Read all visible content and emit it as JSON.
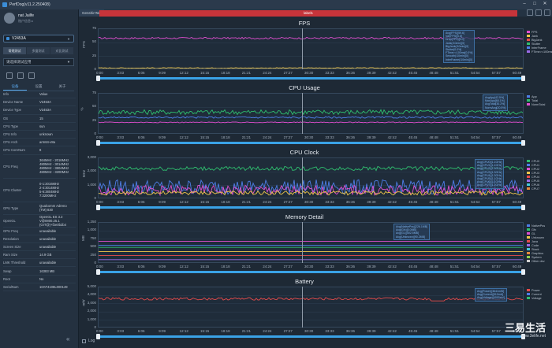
{
  "window": {
    "title": "PerfDog(v11.2.250408)"
  },
  "user": {
    "name": "nat Jailfe",
    "subtitle": "账户信息 ▸"
  },
  "device": {
    "name": "V2453A"
  },
  "mode_tabs": [
    "常规测试",
    "多窗测试",
    "对比测试"
  ],
  "app_select": {
    "placeholder": "请选择测试应用"
  },
  "info_tabs": [
    "设备",
    "设置",
    "关于"
  ],
  "info": [
    {
      "k": "Info",
      "v": "Value"
    },
    {
      "k": "Device Name",
      "v": "V2453A"
    },
    {
      "k": "Device Type",
      "v": "V2453A"
    },
    {
      "k": "OS",
      "v": "15"
    },
    {
      "k": "CPU Type",
      "v": "sun"
    },
    {
      "k": "CPU Info",
      "v": "unknown"
    },
    {
      "k": "CPU Arch",
      "v": "arm64-v8a"
    },
    {
      "k": "CPU CoreNum",
      "v": "8"
    },
    {
      "k": "CPU Freq",
      "v": "364MHz - 2016MHz\n480MHz - 3014MHz\n480MHz - 3804MHz\n480MHz - 3200MHz"
    },
    {
      "k": "CPU Cluster",
      "v": "0-1:2016MHz\n2-4:3014MHz\n5-6:3804MHz\n7:3200MHz"
    },
    {
      "k": "GPU Type",
      "v": "Qualcomm Adreno\n(TM) 830"
    },
    {
      "k": "OpenGL",
      "v": "OpenGL ES 3.2\nV@0800.25.1\n(GIT@)+f2e0b2b4"
    },
    {
      "k": "GPU Freq",
      "v": "unavailable"
    },
    {
      "k": "Resolution",
      "v": "unavailable"
    },
    {
      "k": "Screen Size",
      "v": "unavailable"
    },
    {
      "k": "Ram Size",
      "v": "14.9 GB"
    },
    {
      "k": "LMK Threshold",
      "v": "unavailable"
    },
    {
      "k": "Swap",
      "v": "16383 MB"
    },
    {
      "k": "Root",
      "v": "No"
    },
    {
      "k": "SerialNum",
      "v": "10AF4108L000149"
    }
  ],
  "tabbar": {
    "tab": "GenshinTab",
    "label": "label1"
  },
  "x_ticks": [
    "0:00",
    "3:03",
    "6:06",
    "9:09",
    "12:12",
    "15:15",
    "18:18",
    "21:21",
    "24:24",
    "27:27",
    "30:30",
    "33:33",
    "36:36",
    "39:39",
    "42:42",
    "45:45",
    "48:48",
    "51:51",
    "54:54",
    "57:57",
    "60:49"
  ],
  "panels": [
    {
      "title": "FPS",
      "unit": "FPS",
      "yticks": [
        "75",
        "50",
        "25",
        "0"
      ],
      "ymax": 75,
      "legend": [
        {
          "name": "FPS",
          "color": "#e04fd0"
        },
        {
          "name": "Jank",
          "color": "#f0c64a"
        },
        {
          "name": "BigJank",
          "color": "#e64b4b"
        },
        {
          "name": "Stutter",
          "color": "#2fbf6f"
        },
        {
          "name": "InterFrame",
          "color": "#4d7ee8"
        },
        {
          "name": "FTime>=100ms",
          "color": "#9b6be8"
        }
      ],
      "stats": "Avg(FPS)[59.6]\nVar(FPS)[0.8]\nDrop(FPS)[0.0]\nJank(/10min)[0]\nBigJank(/10min)[0]\nStutter[0.0%]\nFTime>=100ms[0.0%]\nSmooth(/10min)[0]\nInterFrame(/10min)[0]"
    },
    {
      "title": "CPU Usage",
      "unit": "%",
      "yticks": [
        "75",
        "50",
        "25",
        "0"
      ],
      "ymax": 75,
      "legend": [
        {
          "name": "App",
          "color": "#4d7ee8"
        },
        {
          "name": "Total",
          "color": "#2fbf6f"
        },
        {
          "name": "NormTotal",
          "color": "#e04fd0"
        }
      ],
      "stats": "AvgApp[42.5%]\nMaxApp[68.1%]\nAvgTotal[30.2%]\nNormAvg[20.5%]"
    },
    {
      "title": "CPU Clock",
      "unit": "MHz",
      "yticks": [
        "3,000",
        "2,000",
        "1,000",
        "0"
      ],
      "ymax": 4000,
      "legend": [
        {
          "name": "CPU0",
          "color": "#2fbf6f"
        },
        {
          "name": "CPU1",
          "color": "#4d7ee8"
        },
        {
          "name": "CPU2",
          "color": "#e04fd0"
        },
        {
          "name": "CPU3",
          "color": "#f0c64a"
        },
        {
          "name": "CPU4",
          "color": "#e64b4b"
        },
        {
          "name": "CPU5",
          "color": "#9b6be8"
        },
        {
          "name": "CPU6",
          "color": "#45c9d8"
        },
        {
          "name": "CPU7",
          "color": "#e88a3c"
        }
      ],
      "stats": "Avg(CPU0)[1.1GHz]\nAvg(CPU1)[1.1GHz]\nAvg(CPU2)[1.3GHz]\nAvg(CPU3)[1.3GHz]\nAvg(CPU4)[1.3GHz]\nAvg(CPU5)[1.1GHz]\nAvg(CPU6)[1.1GHz]\nAvg(CPU7)[1.2GHz]"
    },
    {
      "title": "Memory Detail",
      "unit": "MB",
      "yticks": [
        "1,250",
        "1,000",
        "750",
        "500",
        "250",
        "0"
      ],
      "ymax": 1250,
      "legend": [
        {
          "name": "NativePss",
          "color": "#4d7ee8"
        },
        {
          "name": "Gfx",
          "color": "#2fbf6f"
        },
        {
          "name": "GL",
          "color": "#e04fd0"
        },
        {
          "name": "Unknown",
          "color": "#f0c64a"
        },
        {
          "name": "Java",
          "color": "#e64b4b"
        },
        {
          "name": "Code",
          "color": "#9b6be8"
        },
        {
          "name": "Stack",
          "color": "#45c9d8"
        },
        {
          "name": "Graphics",
          "color": "#e88a3c"
        },
        {
          "name": "System",
          "color": "#8fd14f"
        },
        {
          "name": "Other dev",
          "color": "#d0d0d0"
        }
      ],
      "stats": "Avg(NativePss)[226.1MB]\nAvg(Gfx)[0.0MB]\nAvg(GL)[502.5MB]\nAvg(Unknown)[90.2MB]"
    },
    {
      "title": "Battery",
      "unit": "mW",
      "yticks": [
        "5,000",
        "4,000",
        "3,000",
        "2,000",
        "1,000",
        "0"
      ],
      "ymax": 5000,
      "legend": [
        {
          "name": "Power",
          "color": "#e64b4b"
        },
        {
          "name": "Current",
          "color": "#4d7ee8"
        },
        {
          "name": "Voltage",
          "color": "#2fbf6f"
        }
      ],
      "stats": "Avg(Power)[3641mW]\nAvg(Current)[910mA]\nAvg(Voltage)[4000mV]"
    }
  ],
  "bottom": {
    "log_label": "Log"
  },
  "watermark": {
    "brand": "三易生活",
    "url": "www.3elife.net"
  }
}
